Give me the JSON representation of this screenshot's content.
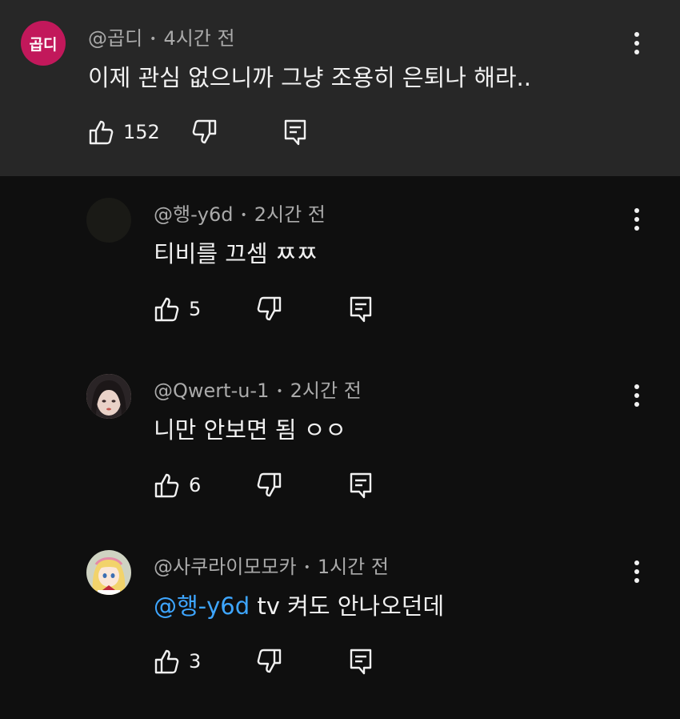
{
  "comments": [
    {
      "author": "@곱디",
      "time": "4시간 전",
      "avatar_text": "곱디",
      "text": "이제 관심 없으니까 그냥 조용히 은퇴나 해라..",
      "likes": "152"
    },
    {
      "author": "@행-y6d",
      "time": "2시간 전",
      "text": "티비를 끄셈 ㅉㅉ",
      "likes": "5"
    },
    {
      "author": "@Qwert-u-1",
      "time": "2시간 전",
      "text": "니만 안보면 됨 ㅇㅇ",
      "likes": "6"
    },
    {
      "author": "@사쿠라이모모카",
      "time": "1시간 전",
      "mention": "@행-y6d",
      "text": " tv 켜도 안나오던데",
      "likes": "3"
    }
  ],
  "colors": {
    "top_bg": "#272727",
    "page_bg": "#0f0f0f",
    "mention": "#3ea6ff",
    "avatar_red": "#c2185b"
  },
  "icons": [
    "like-icon",
    "dislike-icon",
    "reply-icon",
    "more-vertical-icon"
  ]
}
